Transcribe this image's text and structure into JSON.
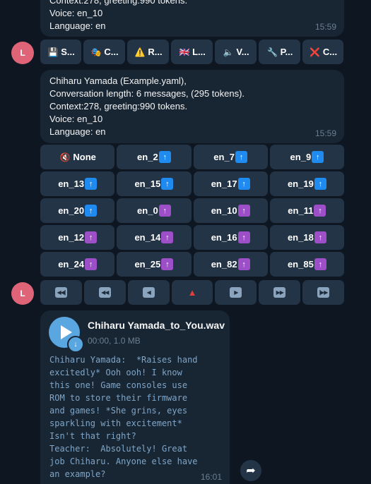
{
  "messages": {
    "top_partial": {
      "lines": [
        "Context:278, greeting:990 tokens.",
        "Voice: en_10",
        "Language: en"
      ],
      "time": "15:59"
    },
    "info": {
      "lines": [
        "Chiharu Yamada (Example.yaml),",
        "Conversation length: 6 messages, (295 tokens).",
        "Context:278, greeting:990 tokens.",
        "Voice: en_10",
        "Language: en"
      ],
      "time": "15:59"
    },
    "audio": {
      "filename": "Chiharu Yamada_to_You.wav",
      "meta": "00:00, 1.0 MB",
      "text": "Chiharu Yamada:  *Raises hand\nexcitedly* Ooh ooh! I know\nthis one! Game consoles use\nROM to store their firmware\nand games! *She grins, eyes\nsparkling with excitement*\nIsn't that right?\nTeacher:  Absolutely! Great\njob Chiharu. Anyone else have\nan example?",
      "time": "16:01"
    }
  },
  "avatar": {
    "initial": "L",
    "color": "#e06477"
  },
  "action_buttons": [
    {
      "icon": "💾",
      "label": "S..."
    },
    {
      "icon": "🎭",
      "label": "C..."
    },
    {
      "icon": "⚠️",
      "label": "R..."
    },
    {
      "icon": "🇬🇧",
      "label": "L..."
    },
    {
      "icon": "🔈",
      "label": "V..."
    },
    {
      "icon": "🔧",
      "label": "P..."
    },
    {
      "icon": "❌",
      "label": "C..."
    }
  ],
  "voice_buttons": [
    {
      "label": "None",
      "kind": "mute"
    },
    {
      "label": "en_2",
      "kind": "male"
    },
    {
      "label": "en_7",
      "kind": "male"
    },
    {
      "label": "en_9",
      "kind": "male"
    },
    {
      "label": "en_13",
      "kind": "male"
    },
    {
      "label": "en_15",
      "kind": "male"
    },
    {
      "label": "en_17",
      "kind": "male"
    },
    {
      "label": "en_19",
      "kind": "male"
    },
    {
      "label": "en_20",
      "kind": "male"
    },
    {
      "label": "en_0",
      "kind": "female"
    },
    {
      "label": "en_10",
      "kind": "female"
    },
    {
      "label": "en_11",
      "kind": "female"
    },
    {
      "label": "en_12",
      "kind": "female"
    },
    {
      "label": "en_14",
      "kind": "female"
    },
    {
      "label": "en_16",
      "kind": "female"
    },
    {
      "label": "en_18",
      "kind": "female"
    },
    {
      "label": "en_24",
      "kind": "female"
    },
    {
      "label": "en_25",
      "kind": "female"
    },
    {
      "label": "en_82",
      "kind": "female"
    },
    {
      "label": "en_85",
      "kind": "female"
    }
  ],
  "nav_buttons": [
    {
      "icon": "first-page-icon",
      "glyph": "◀◀|"
    },
    {
      "icon": "rewind-icon",
      "glyph": "◀◀"
    },
    {
      "icon": "previous-icon",
      "glyph": "◀"
    },
    {
      "icon": "current-triangle-icon",
      "glyph": "▲"
    },
    {
      "icon": "next-icon",
      "glyph": "▶"
    },
    {
      "icon": "fast-forward-icon",
      "glyph": "▶▶"
    },
    {
      "icon": "last-page-icon",
      "glyph": "|▶▶"
    }
  ],
  "colors": {
    "background": "#0e1621",
    "bubble": "#182533",
    "button": "#243447",
    "male_icon": "#1f8bf0",
    "female_icon": "#9c4fc7",
    "timestamp": "#6d7f8f",
    "audio_text": "#7fa6c8"
  }
}
